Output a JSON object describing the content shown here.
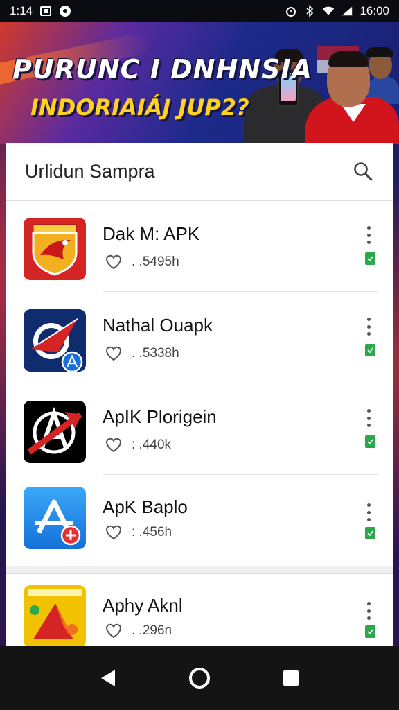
{
  "status_bar": {
    "time": "1:14",
    "clock_right": "16:00",
    "icons_left": [
      "gallery-icon",
      "chat-icon"
    ],
    "icons_right": [
      "alarm-icon",
      "bluetooth-icon",
      "wifi-icon",
      "signal-icon"
    ]
  },
  "banner": {
    "headline": "PURUNC I DNHNSIA",
    "subheadline": "INDORIAIÁJ JUP2?"
  },
  "search": {
    "title": "Urlidun Sampra",
    "icon": "search-icon"
  },
  "apps": [
    {
      "name": "Dak  M: APK",
      "meta": ". .5495h",
      "icon": "shield-bird-icon",
      "accent": "#d42424"
    },
    {
      "name": "Nathal Ouapk",
      "meta": ". .5338h",
      "icon": "arrow-check-icon",
      "accent": "#0f2d6e"
    },
    {
      "name": "ApIK Plorigein",
      "meta": ": .440k",
      "icon": "a-cross-icon",
      "accent": "#000000"
    },
    {
      "name": "ApK Baplo",
      "meta": ": .456h",
      "icon": "app-store-plus-icon",
      "accent": "#1e8ee8"
    },
    {
      "name": "Aphy Aknl",
      "meta": ". .296n",
      "icon": "yellow-arrow-icon",
      "accent": "#f2c200"
    }
  ],
  "nav": {
    "back": "back-icon",
    "home": "home-icon",
    "recents": "recents-icon"
  }
}
